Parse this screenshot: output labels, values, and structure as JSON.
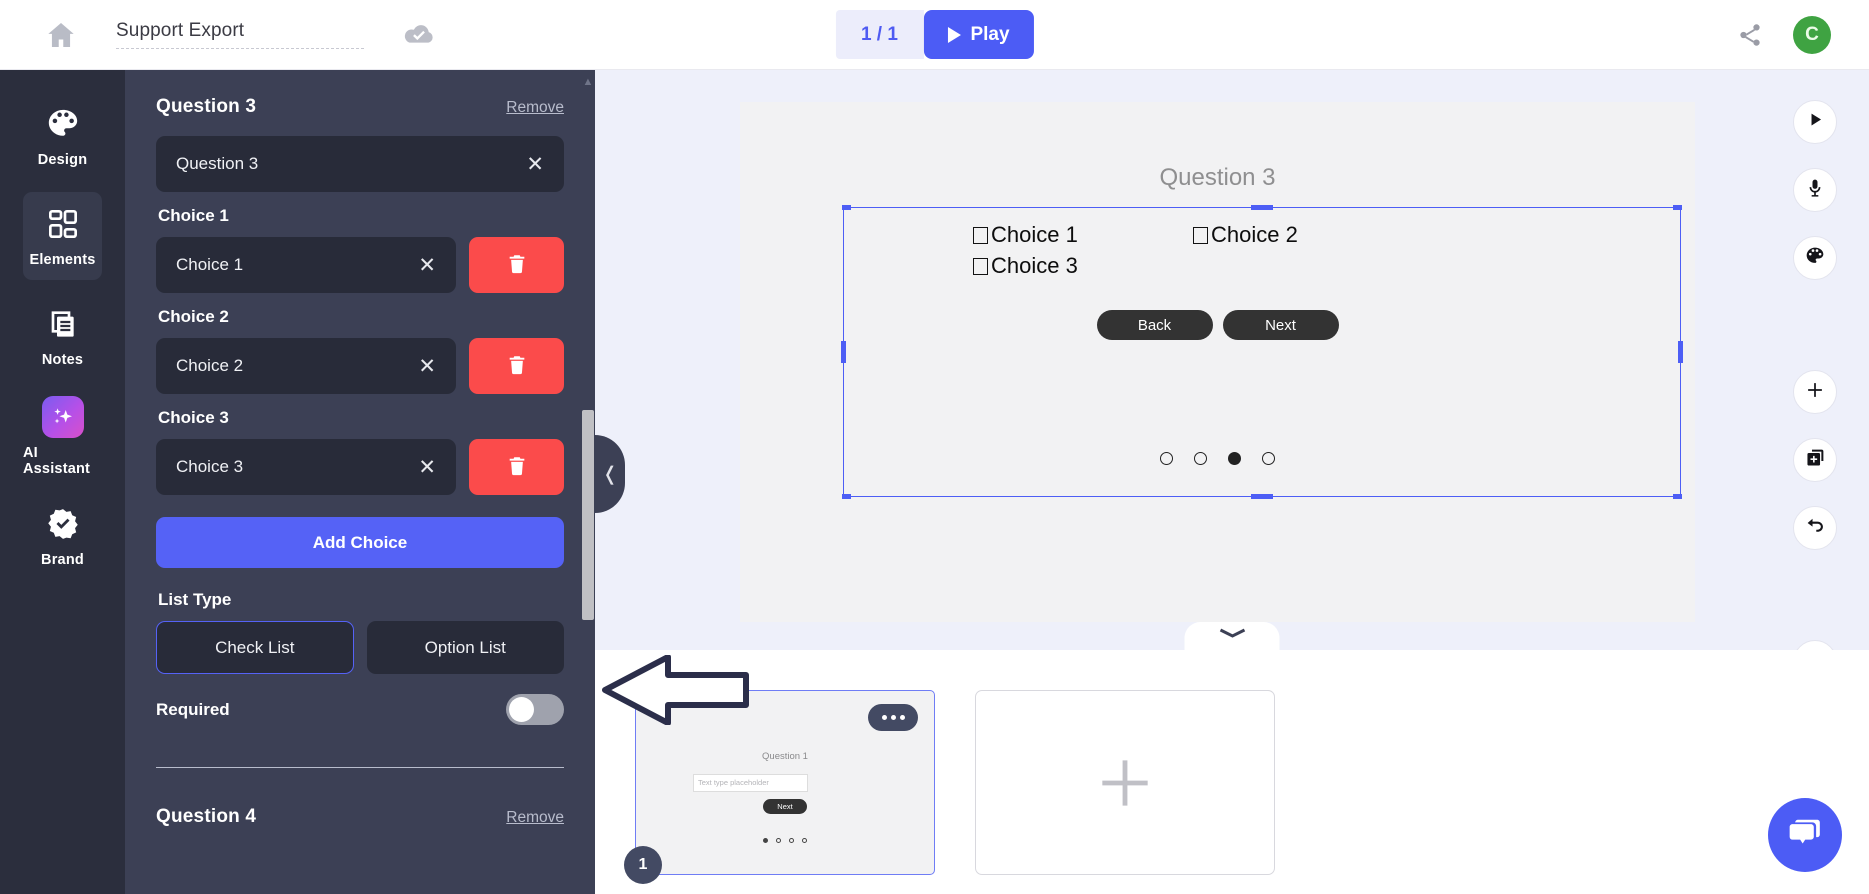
{
  "topbar": {
    "home_icon": "home-icon",
    "doc_title": "Support Export",
    "save_status_icon": "cloud-check-icon",
    "page_count": "1 / 1",
    "play_label": "Play",
    "share_icon": "share-icon",
    "avatar_initial": "C",
    "accent": "#4c5cf5",
    "avatar_color": "#3fa342"
  },
  "rail": {
    "items": [
      {
        "label": "Design",
        "icon": "palette-icon",
        "active": false
      },
      {
        "label": "Elements",
        "icon": "elements-icon",
        "active": true
      },
      {
        "label": "Notes",
        "icon": "notes-icon",
        "active": false
      },
      {
        "label": "AI Assistant",
        "icon": "sparkles-icon",
        "active": false
      },
      {
        "label": "Brand",
        "icon": "badge-check-icon",
        "active": false
      }
    ]
  },
  "panel": {
    "question_heading": "Question 3",
    "remove_label": "Remove",
    "question_value": "Question 3",
    "question_placeholder": "Question 3",
    "choices": [
      {
        "label": "Choice 1",
        "value": "Choice 1"
      },
      {
        "label": "Choice 2",
        "value": "Choice 2"
      },
      {
        "label": "Choice 3",
        "value": "Choice 3"
      }
    ],
    "add_choice_label": "Add Choice",
    "list_type_label": "List Type",
    "list_type_options": [
      "Check List",
      "Option List"
    ],
    "list_type_selected": "Check List",
    "required_label": "Required",
    "required_on": false,
    "next_question_heading": "Question 4",
    "next_remove_label": "Remove",
    "clear_icon": "close-x-icon",
    "delete_icon": "trash-icon",
    "accent": "#5562f6",
    "danger": "#fb4b4b"
  },
  "collapse_handle": {
    "icon": "chevron-left-icon"
  },
  "canvas": {
    "slide": {
      "question_title": "Question 3",
      "choices": [
        "Choice 1",
        "Choice 2",
        "Choice 3"
      ],
      "buttons": [
        "Back",
        "Next"
      ],
      "dots_total": 4,
      "dots_active_index": 2
    },
    "selection_color": "#4d5ef5"
  },
  "right_tools": [
    {
      "icon": "play-icon",
      "name": "preview-button"
    },
    {
      "icon": "microphone-icon",
      "name": "record-audio-button"
    },
    {
      "icon": "palette-icon",
      "name": "slide-theme-button"
    },
    {
      "icon": "plus-icon",
      "name": "add-slide-button"
    },
    {
      "icon": "duplicate-icon",
      "name": "duplicate-slide-button"
    },
    {
      "icon": "undo-icon",
      "name": "undo-button"
    },
    {
      "icon": "trash-icon",
      "name": "delete-slide-button"
    }
  ],
  "tray": {
    "notch_icon": "chevron-down-icon",
    "slides": [
      {
        "number": "1",
        "question_title": "Question 1",
        "input_placeholder": "Text type placeholder",
        "next_label": "Next",
        "dots_total": 4,
        "dots_active_index": 0,
        "more_icon": "ellipsis-icon"
      }
    ],
    "add_slide_icon": "plus-icon"
  },
  "chat": {
    "icon": "chat-bubble-icon",
    "color": "#4c5cf5"
  },
  "annotation": {
    "arrow": "left-pointing-arrow"
  }
}
